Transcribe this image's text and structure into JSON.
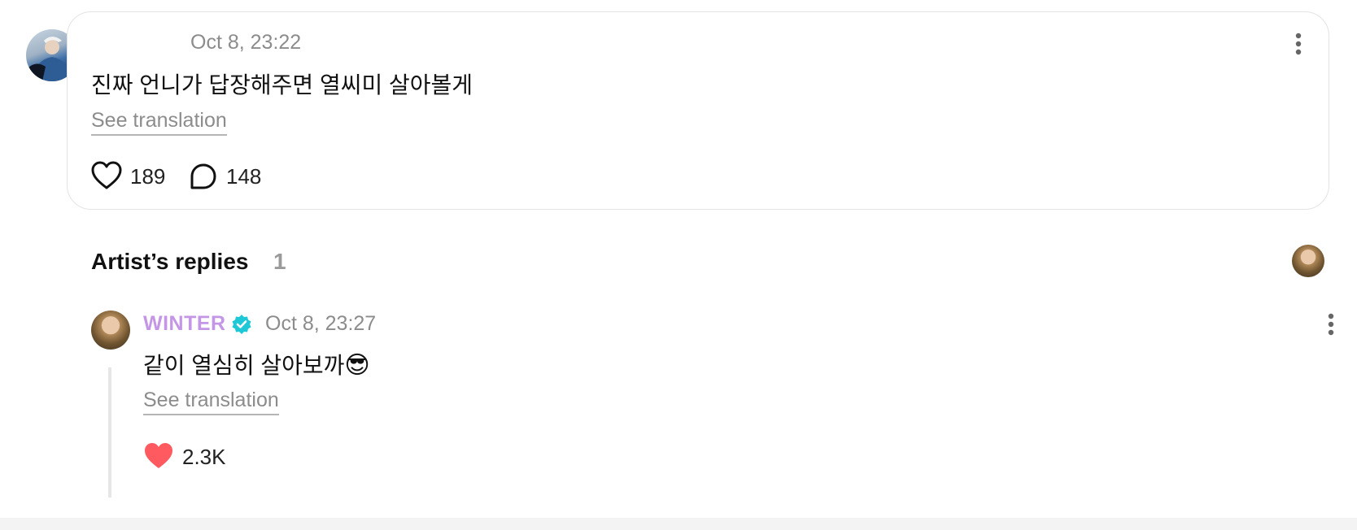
{
  "comment": {
    "timestamp": "Oct 8, 23:22",
    "text": "진짜 언니가 답장해주면 열씨미 살아볼게",
    "see_translation": "See translation",
    "likes": "189",
    "replies": "148"
  },
  "artist_replies": {
    "title": "Artist’s replies",
    "count": "1"
  },
  "reply": {
    "author": "WINTER",
    "timestamp": "Oct 8, 23:27",
    "text": "같이 열심히 살아보까",
    "emoji": "😎",
    "see_translation": "See translation",
    "likes": "2.3K"
  },
  "colors": {
    "artist_name": "#c496e6",
    "verified_badge": "#1ec8d6",
    "liked_heart": "#ff5a5f",
    "muted_text": "#8c8c8c"
  }
}
